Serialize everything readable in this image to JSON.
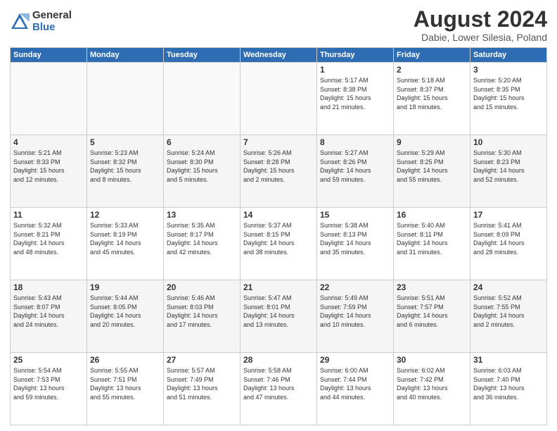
{
  "logo": {
    "general": "General",
    "blue": "Blue"
  },
  "title": "August 2024",
  "subtitle": "Dabie, Lower Silesia, Poland",
  "headers": [
    "Sunday",
    "Monday",
    "Tuesday",
    "Wednesday",
    "Thursday",
    "Friday",
    "Saturday"
  ],
  "weeks": [
    [
      {
        "day": "",
        "info": ""
      },
      {
        "day": "",
        "info": ""
      },
      {
        "day": "",
        "info": ""
      },
      {
        "day": "",
        "info": ""
      },
      {
        "day": "1",
        "info": "Sunrise: 5:17 AM\nSunset: 8:38 PM\nDaylight: 15 hours\nand 21 minutes."
      },
      {
        "day": "2",
        "info": "Sunrise: 5:18 AM\nSunset: 8:37 PM\nDaylight: 15 hours\nand 18 minutes."
      },
      {
        "day": "3",
        "info": "Sunrise: 5:20 AM\nSunset: 8:35 PM\nDaylight: 15 hours\nand 15 minutes."
      }
    ],
    [
      {
        "day": "4",
        "info": "Sunrise: 5:21 AM\nSunset: 8:33 PM\nDaylight: 15 hours\nand 12 minutes."
      },
      {
        "day": "5",
        "info": "Sunrise: 5:23 AM\nSunset: 8:32 PM\nDaylight: 15 hours\nand 8 minutes."
      },
      {
        "day": "6",
        "info": "Sunrise: 5:24 AM\nSunset: 8:30 PM\nDaylight: 15 hours\nand 5 minutes."
      },
      {
        "day": "7",
        "info": "Sunrise: 5:26 AM\nSunset: 8:28 PM\nDaylight: 15 hours\nand 2 minutes."
      },
      {
        "day": "8",
        "info": "Sunrise: 5:27 AM\nSunset: 8:26 PM\nDaylight: 14 hours\nand 59 minutes."
      },
      {
        "day": "9",
        "info": "Sunrise: 5:29 AM\nSunset: 8:25 PM\nDaylight: 14 hours\nand 55 minutes."
      },
      {
        "day": "10",
        "info": "Sunrise: 5:30 AM\nSunset: 8:23 PM\nDaylight: 14 hours\nand 52 minutes."
      }
    ],
    [
      {
        "day": "11",
        "info": "Sunrise: 5:32 AM\nSunset: 8:21 PM\nDaylight: 14 hours\nand 48 minutes."
      },
      {
        "day": "12",
        "info": "Sunrise: 5:33 AM\nSunset: 8:19 PM\nDaylight: 14 hours\nand 45 minutes."
      },
      {
        "day": "13",
        "info": "Sunrise: 5:35 AM\nSunset: 8:17 PM\nDaylight: 14 hours\nand 42 minutes."
      },
      {
        "day": "14",
        "info": "Sunrise: 5:37 AM\nSunset: 8:15 PM\nDaylight: 14 hours\nand 38 minutes."
      },
      {
        "day": "15",
        "info": "Sunrise: 5:38 AM\nSunset: 8:13 PM\nDaylight: 14 hours\nand 35 minutes."
      },
      {
        "day": "16",
        "info": "Sunrise: 5:40 AM\nSunset: 8:11 PM\nDaylight: 14 hours\nand 31 minutes."
      },
      {
        "day": "17",
        "info": "Sunrise: 5:41 AM\nSunset: 8:09 PM\nDaylight: 14 hours\nand 28 minutes."
      }
    ],
    [
      {
        "day": "18",
        "info": "Sunrise: 5:43 AM\nSunset: 8:07 PM\nDaylight: 14 hours\nand 24 minutes."
      },
      {
        "day": "19",
        "info": "Sunrise: 5:44 AM\nSunset: 8:05 PM\nDaylight: 14 hours\nand 20 minutes."
      },
      {
        "day": "20",
        "info": "Sunrise: 5:46 AM\nSunset: 8:03 PM\nDaylight: 14 hours\nand 17 minutes."
      },
      {
        "day": "21",
        "info": "Sunrise: 5:47 AM\nSunset: 8:01 PM\nDaylight: 14 hours\nand 13 minutes."
      },
      {
        "day": "22",
        "info": "Sunrise: 5:49 AM\nSunset: 7:59 PM\nDaylight: 14 hours\nand 10 minutes."
      },
      {
        "day": "23",
        "info": "Sunrise: 5:51 AM\nSunset: 7:57 PM\nDaylight: 14 hours\nand 6 minutes."
      },
      {
        "day": "24",
        "info": "Sunrise: 5:52 AM\nSunset: 7:55 PM\nDaylight: 14 hours\nand 2 minutes."
      }
    ],
    [
      {
        "day": "25",
        "info": "Sunrise: 5:54 AM\nSunset: 7:53 PM\nDaylight: 13 hours\nand 59 minutes."
      },
      {
        "day": "26",
        "info": "Sunrise: 5:55 AM\nSunset: 7:51 PM\nDaylight: 13 hours\nand 55 minutes."
      },
      {
        "day": "27",
        "info": "Sunrise: 5:57 AM\nSunset: 7:49 PM\nDaylight: 13 hours\nand 51 minutes."
      },
      {
        "day": "28",
        "info": "Sunrise: 5:58 AM\nSunset: 7:46 PM\nDaylight: 13 hours\nand 47 minutes."
      },
      {
        "day": "29",
        "info": "Sunrise: 6:00 AM\nSunset: 7:44 PM\nDaylight: 13 hours\nand 44 minutes."
      },
      {
        "day": "30",
        "info": "Sunrise: 6:02 AM\nSunset: 7:42 PM\nDaylight: 13 hours\nand 40 minutes."
      },
      {
        "day": "31",
        "info": "Sunrise: 6:03 AM\nSunset: 7:40 PM\nDaylight: 13 hours\nand 36 minutes."
      }
    ]
  ]
}
